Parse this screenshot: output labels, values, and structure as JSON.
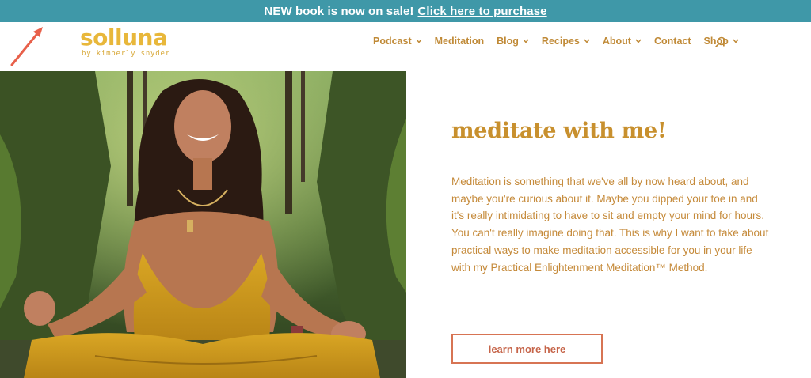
{
  "announcement": {
    "text": "NEW book is now on sale!",
    "link_label": "Click here to purchase"
  },
  "logo": {
    "name": "solluna",
    "tagline": "by kimberly snyder"
  },
  "nav": {
    "items": [
      {
        "label": "Podcast",
        "has_dropdown": true
      },
      {
        "label": "Meditation",
        "has_dropdown": false
      },
      {
        "label": "Blog",
        "has_dropdown": true
      },
      {
        "label": "Recipes",
        "has_dropdown": true
      },
      {
        "label": "About",
        "has_dropdown": true
      },
      {
        "label": "Contact",
        "has_dropdown": false
      },
      {
        "label": "Shop",
        "has_dropdown": true
      }
    ],
    "search_icon": "search-icon"
  },
  "hero": {
    "heading": "meditate with me!",
    "paragraph": "Meditation is something that we've all by now heard about, and maybe you're curious about it. Maybe you dipped your toe in and it's really intimidating to have to sit and empty your mind for hours. You can't really imagine doing that. This is why I want to take about practical ways to make meditation accessible for you in your life with my Practical Enlightenment Meditation™ Method.",
    "cta_label": "learn more here"
  },
  "colors": {
    "announcement_bg": "#3f98a8",
    "logo": "#e8b73a",
    "nav_text": "#c08a37",
    "heading": "#c8902e",
    "body_text": "#c58a3a",
    "cta_border": "#d77453",
    "annotation_arrow": "#e8604a"
  }
}
